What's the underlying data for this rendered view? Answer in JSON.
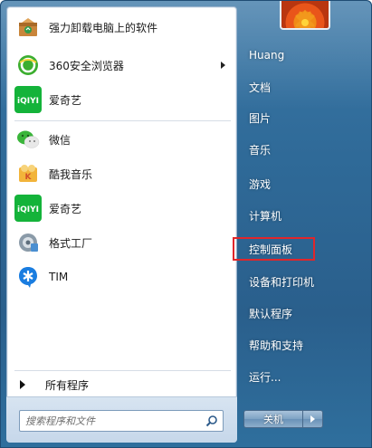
{
  "programs": [
    {
      "label": "强力卸载电脑上的软件",
      "icon": "uninstaller-box-icon"
    },
    {
      "label": "360安全浏览器",
      "icon": "360-browser-icon",
      "has_submenu": true
    },
    {
      "label": "爱奇艺",
      "icon": "iqiyi-icon"
    },
    {
      "label": "微信",
      "icon": "wechat-icon"
    },
    {
      "label": "酷我音乐",
      "icon": "kuwo-music-icon"
    },
    {
      "label": "爱奇艺",
      "icon": "iqiyi-icon"
    },
    {
      "label": "格式工厂",
      "icon": "format-factory-icon"
    },
    {
      "label": "TIM",
      "icon": "tim-icon"
    }
  ],
  "all_programs_label": "所有程序",
  "search": {
    "placeholder": "搜索程序和文件"
  },
  "user": {
    "name": "Huang"
  },
  "right_items": [
    "文档",
    "图片",
    "音乐",
    "游戏",
    "计算机",
    "控制面板",
    "设备和打印机",
    "默认程序",
    "帮助和支持",
    "运行..."
  ],
  "highlighted_item": "控制面板",
  "shutdown_label": "关机",
  "colors": {
    "highlight": "#e0262b",
    "iqiyi": "#14b33a",
    "wechat": "#3ab53a",
    "tim": "#1a7de0"
  }
}
